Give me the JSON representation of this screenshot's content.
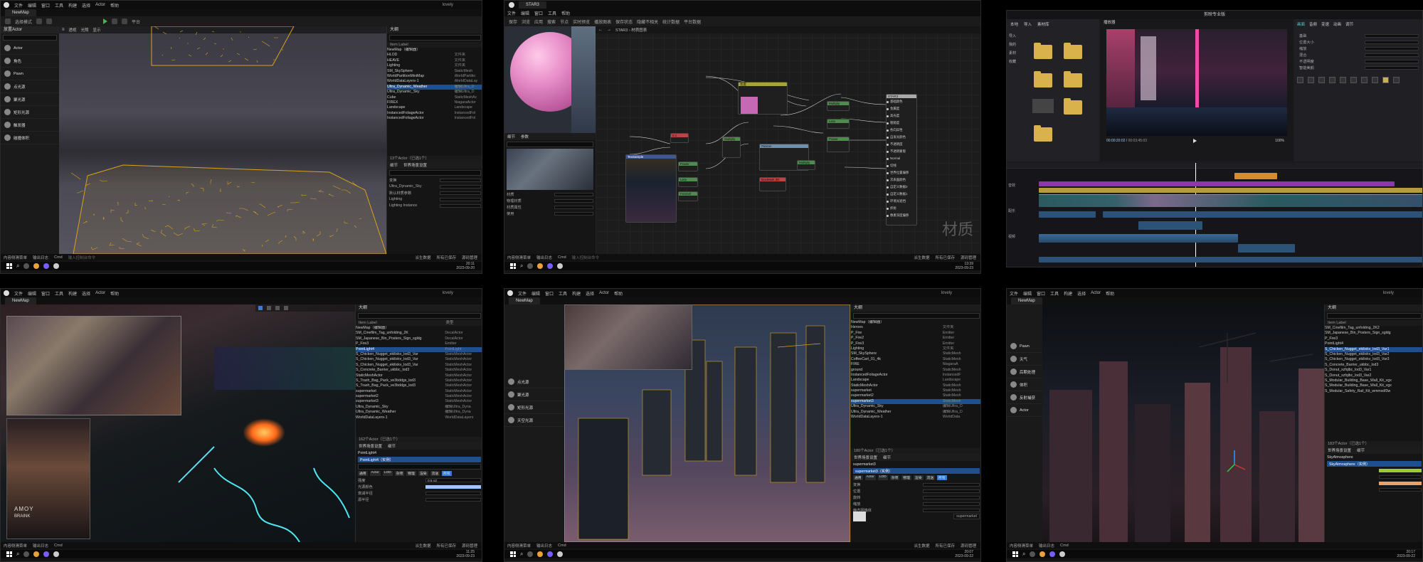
{
  "menu": [
    "文件",
    "编辑",
    "窗口",
    "工具",
    "构建",
    "选择",
    "Actor",
    "帮助"
  ],
  "panel1": {
    "window_title": "lovely",
    "tab": "NewMap",
    "toolbar": [
      "选择模式",
      "平台"
    ],
    "vp_labels": [
      "透视",
      "光照",
      "显示"
    ],
    "left_items": [
      "Actor",
      "角色",
      "Pawn",
      "点光源",
      "聚光源",
      "矩形光源",
      "触发器",
      "碰撞体积"
    ],
    "outliner_title": "大纲",
    "outliner_col": "Item Label",
    "outliner_rows": [
      {
        "n": "NewMap（编辑器）",
        "t": ""
      },
      {
        "n": "HLOD",
        "t": "文件夹"
      },
      {
        "n": "HEAVE",
        "t": "文件夹"
      },
      {
        "n": "Lighting",
        "t": "文件夹"
      },
      {
        "n": "SM_SkySphere",
        "t": "StaticMesh"
      },
      {
        "n": "WorldPartitionMiniMap",
        "t": "WorldPartitio"
      },
      {
        "n": "WorldDataLayers-1",
        "t": "WorldDataLay"
      },
      {
        "n": "Ultra_Dynamic_Weather",
        "t": "编辑Ultra_D"
      },
      {
        "n": "Ultra_Dynamic_Sky",
        "t": "编辑Ultra_D"
      },
      {
        "n": "Cube",
        "t": "StaticMeshAc"
      },
      {
        "n": "FIREX",
        "t": "NiagaraActor"
      },
      {
        "n": "Landscape",
        "t": "Landscape"
      },
      {
        "n": "InstancedFoliageActor",
        "t": "InstancedFol"
      },
      {
        "n": "InstancedFoliageActor",
        "t": "InstancedFol"
      }
    ],
    "selected_row": 7,
    "actor_count": "13个Actor（已选1个）",
    "details_tabs": [
      "细节",
      "世界场景设置"
    ],
    "details_rows": [
      "变换",
      "Ultra_Dynamic_Sky",
      "默认材质参数",
      "Lighting",
      "Lighting Instance"
    ],
    "status": [
      "内容侧滑菜单",
      "输出日志",
      "Cmd",
      "输入控制台命令",
      "派生数据",
      "所有已保存",
      "源码管理"
    ],
    "clock_time": "20:11",
    "clock_date": "2023-09-20"
  },
  "panel2": {
    "tab": "STAR3",
    "toolbar": [
      "保存",
      "浏览",
      "应用",
      "搜索",
      "节点",
      "实时预览",
      "播放图表",
      "保存状态",
      "隐藏不相关",
      "统计数据",
      "平台数据"
    ],
    "breadcrumb": "STAR3 › 材质图表",
    "detail_tabs": [
      "细节",
      "参数"
    ],
    "detail_rows": [
      "材质",
      "物理材质",
      "材质属性",
      "使用"
    ],
    "nodes": {
      "param": "亮度",
      "power": "Power",
      "multiply": "Multiply",
      "lerp": "Lerp",
      "texsample": "TexSample",
      "panner": "Panner",
      "output": "STAR3",
      "fresnel": "Fresnel",
      "boxmask": "BoxMask 3D",
      "const": "0.1"
    },
    "output_pins": [
      "基础颜色",
      "金属度",
      "高光度",
      "粗糙度",
      "各向异性",
      "自发光颜色",
      "不透明度",
      "不透明蒙版",
      "Normal",
      "切线",
      "世界位置偏移",
      "次表面颜色",
      "自定义数据0",
      "自定义数据1",
      "环境光遮挡",
      "折射",
      "像素深度偏移"
    ],
    "watermark": "材质",
    "status": [
      "内容侧滑菜单",
      "输出日志",
      "Cmd",
      "输入控制台命令",
      "派生数据",
      "所有已保存",
      "源码管理"
    ],
    "clock_time": "13:39",
    "clock_date": "2023-09-23"
  },
  "panel3": {
    "app_title": "剪映专业版",
    "left_tabs": [
      "本地",
      "导入",
      "素材库"
    ],
    "left_items": [
      "导入",
      "我的",
      "素材",
      "收藏"
    ],
    "player_title": "播放器",
    "timecode": "00:00:20:02",
    "duration": "00:03:45:03",
    "right_tabs": [
      "画面",
      "音频",
      "变速",
      "动画",
      "调节"
    ],
    "right_labels": [
      "基础",
      "位置大小",
      "缩放",
      "混合",
      "不透明度",
      "智能美颜"
    ],
    "track_labels": [
      "音效",
      "配乐",
      "视频"
    ],
    "ratio": "100%"
  },
  "panel4": {
    "window_title": "lovely",
    "tab": "NewMap",
    "outliner_title": "大纲",
    "outliner_col": "Item Label",
    "type_col": "类型",
    "outliner_rows": [
      {
        "n": "NewMap（编辑器）",
        "t": ""
      },
      {
        "n": "SM_Cinefilm_Tag_unfolding_2K",
        "t": "DecalActor"
      },
      {
        "n": "SM_Japanese_Bin_Posters_Sign_sgldg",
        "t": "DecalActor"
      },
      {
        "n": "P_Fire3",
        "t": "Emitter"
      },
      {
        "n": "PointLight4",
        "t": "PointLight"
      },
      {
        "n": "S_Chicken_Nugget_ekilixkv_lod3_Var",
        "t": "StaticMeshActor"
      },
      {
        "n": "S_Chicken_Nugget_ekilixkv_lod3_Var",
        "t": "StaticMeshActor"
      },
      {
        "n": "S_Chicken_Nugget_ekilixkv_lod3_Var",
        "t": "StaticMeshActor"
      },
      {
        "n": "S_Concrete_Barrier_ukbbc_lod3",
        "t": "StaticMeshActor"
      },
      {
        "n": "StaticMeshActor",
        "t": "StaticMeshActor"
      },
      {
        "n": "S_Trash_Bag_Pack_ve3bddgs_lod3",
        "t": "StaticMeshActor"
      },
      {
        "n": "S_Trash_Bag_Pack_ve3bddgs_lod3",
        "t": "StaticMeshActor"
      },
      {
        "n": "supermarket",
        "t": "StaticMeshActor"
      },
      {
        "n": "supermarket2",
        "t": "StaticMeshActor"
      },
      {
        "n": "supermarket3",
        "t": "StaticMeshActor"
      },
      {
        "n": "Ultra_Dynamic_Sky",
        "t": "编辑Ultra_Dyna"
      },
      {
        "n": "Ultra_Dynamic_Weather",
        "t": "编辑Ultra_Dyna"
      },
      {
        "n": "WorldDataLayers-1",
        "t": "WorldDataLayers"
      }
    ],
    "selected_row": 4,
    "actor_count": "162个Actor（已选1个）",
    "details_tabs": [
      "世界场景设置",
      "细节"
    ],
    "selected_actor": "PointLight4",
    "selected_comp": "PointLight4（实例）",
    "cat_tabs": [
      "通用",
      "Actor",
      "LOD",
      "杂项",
      "物理",
      "渲染",
      "流送",
      "所有"
    ],
    "props": [
      "强度",
      "光源颜色",
      "衰减半径",
      "源半径"
    ],
    "intensity": "0.5 cd",
    "neon_text": "AMOY",
    "neon_text2": "BRAINK",
    "clock_time": "11:25",
    "clock_date": "2023-09-23"
  },
  "panel5": {
    "window_title": "lovely",
    "tab": "NewMap",
    "left_items": [
      "点光源",
      "聚光源",
      "矩形光源",
      "天空光源"
    ],
    "outliner_title": "大纲",
    "outliner_rows": [
      {
        "n": "NewMap（编辑器）",
        "t": ""
      },
      {
        "n": "Heroes",
        "t": "文件夹"
      },
      {
        "n": "P_Fire",
        "t": "Emitter"
      },
      {
        "n": "P_Fire2",
        "t": "Emitter"
      },
      {
        "n": "P_Fire3",
        "t": "Emitter"
      },
      {
        "n": "Lighting",
        "t": "文件夹"
      },
      {
        "n": "SM_SkySphere",
        "t": "StaticMesh"
      },
      {
        "n": "CoffeeCart_01_4k",
        "t": "StaticMesh"
      },
      {
        "n": "FIRE",
        "t": "NiagaraA"
      },
      {
        "n": "ground",
        "t": "StaticMesh"
      },
      {
        "n": "InstancedFoliageActor",
        "t": "InstancedF"
      },
      {
        "n": "Landscape",
        "t": "Landscape"
      },
      {
        "n": "StaticMeshActor",
        "t": "StaticMesh"
      },
      {
        "n": "supermarket",
        "t": "StaticMesh"
      },
      {
        "n": "supermarket2",
        "t": "StaticMesh"
      },
      {
        "n": "supermarket3",
        "t": "StaticMesh"
      },
      {
        "n": "Ultra_Dynamic_Sky",
        "t": "编辑Ultra_D"
      },
      {
        "n": "Ultra_Dynamic_Weather",
        "t": "编辑Ultra_D"
      },
      {
        "n": "WorldDataLayers-1",
        "t": "WorldData"
      }
    ],
    "selected_row": 15,
    "actor_count": "180个Actor（已选1个）",
    "selected_actor": "supermarket3",
    "selected_comp": "supermarket3（实例）",
    "cat_tabs": [
      "通用",
      "Actor",
      "LOD",
      "杂项",
      "物理",
      "渲染",
      "流送",
      "所有"
    ],
    "props": [
      "变换",
      "位置",
      "旋转",
      "缩放",
      "静态网格体"
    ],
    "mesh_value": "supermarket",
    "clock_time": "20:07",
    "clock_date": "2023-09-22"
  },
  "panel6": {
    "window_title": "lovely",
    "tab": "NewMap",
    "left_items": [
      "Pawn",
      "天气",
      "后期处理",
      "体积",
      "反射捕获",
      "Actor"
    ],
    "outliner_title": "大纲",
    "outliner_col": "Item Label",
    "outliner_rows": [
      {
        "n": "SM_Cinefilm_Tag_unfolding_2K2",
        "t": ""
      },
      {
        "n": "SM_Japanese_Bin_Posters_Sign_sgldg",
        "t": ""
      },
      {
        "n": "P_Fire3",
        "t": ""
      },
      {
        "n": "PointLight4",
        "t": ""
      },
      {
        "n": "S_Chicken_Nugget_ekilixkv_lod3_Var1",
        "t": ""
      },
      {
        "n": "S_Chicken_Nugget_ekilixkv_lod3_Var2",
        "t": ""
      },
      {
        "n": "S_Chicken_Nugget_ekilixkv_lod3_Var3",
        "t": ""
      },
      {
        "n": "S_Concrete_Barrier_ukbbc_lod3",
        "t": ""
      },
      {
        "n": "S_Donut_xzfqlbc_lod3_Var1",
        "t": ""
      },
      {
        "n": "S_Donut_xzfqlbc_lod3_Var2",
        "t": ""
      },
      {
        "n": "S_Modular_Building_Base_Wall_Kit_vgx",
        "t": ""
      },
      {
        "n": "S_Modular_Building_Base_Wall_Kit_vgx",
        "t": ""
      },
      {
        "n": "S_Modular_Safety_Rail_Kit_wmmxdf3w",
        "t": ""
      }
    ],
    "selected_row": 4,
    "actor_count": "183个Actor（已选1个）",
    "details_tabs": [
      "世界场景设置",
      "细节"
    ],
    "selected_actor": "SkyAtmosphere",
    "selected_comp": "SkyAtmosphere（实例）",
    "clock_time": "20:17",
    "clock_date": "2023-09-22"
  }
}
